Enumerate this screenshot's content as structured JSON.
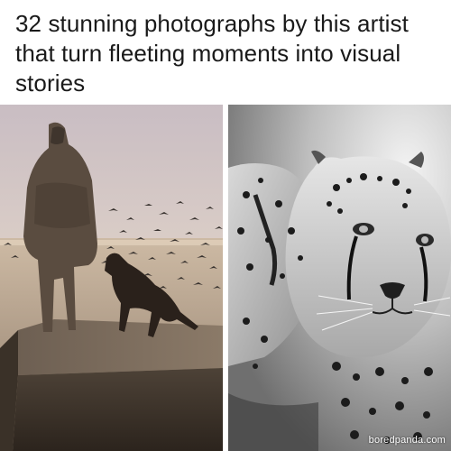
{
  "post": {
    "headline": "32 stunning photographs by this artist that turn fleeting moments into visual stories"
  },
  "photos": [
    {
      "subject": "man-with-dog-and-birds-photo"
    },
    {
      "subject": "cheetahs-bw-photo"
    }
  ],
  "watermark": {
    "text": "boredpanda.com"
  }
}
